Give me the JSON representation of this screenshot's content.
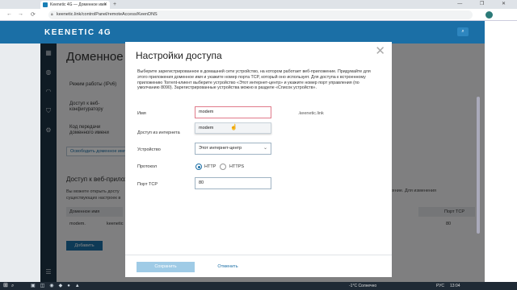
{
  "browser": {
    "tab_title": "Keenetic 4G — Доменное имя",
    "tab_close": "✕",
    "new_tab": "+",
    "window_controls": "— ❐ ✕",
    "url": "keenetic.link/controlPanel/remoteAccess/KeenDNS",
    "back": "←",
    "forward": "→",
    "reload": "⟳"
  },
  "app": {
    "brand": "KEENETIC 4G",
    "search_icon": "⌕"
  },
  "sidebar": {
    "icons": [
      "dashboard-icon",
      "globe-icon",
      "wifi-icon",
      "shield-icon",
      "gear-icon",
      "menu-icon"
    ]
  },
  "background": {
    "page_title": "Доменное",
    "labels": [
      "Режим работы (IPv6)",
      "Доступ к веб-конфигуратору",
      "Код передачи доменного имени"
    ],
    "link": "Освободить доменное имя",
    "section_title": "Доступ к веб-прилож",
    "text": "Вы можете открыть досту\nсуществующих настроек в",
    "right_text": "жение. Для изменения",
    "table_headers": [
      "Доменное имя",
      "Порт TCP"
    ],
    "table_row": [
      "modem.",
      "keenetic",
      "80"
    ],
    "add_button": "Добавить"
  },
  "dialog": {
    "title": "Настройки доступа",
    "close": "✕",
    "description": "Выберите зарегистрированное в домашней сети устройство, на котором работает веб-приложение. Придумайте для этого приложения доменное имя и укажите номер порта TCP, который оно использует. Для доступа к встроенному приложению Torrent-клиент выберите устройство «Этот интернет-центр» и укажите номер порт управления (по умолчанию 8090). Зарегистрированные устройства можно в разделе «Список устройств».",
    "fields": {
      "name_label": "Имя",
      "name_value": "modem",
      "name_suffix": ".keenetic.link",
      "suggestion": "modem",
      "access_label": "Доступ из интернета",
      "device_label": "Устройство",
      "device_value": "Этот интернет-центр",
      "protocol_label": "Протокол",
      "protocol_http": "HTTP",
      "protocol_https": "HTTPS",
      "port_label": "Порт TCP",
      "port_value": "80"
    },
    "save_button": "Сохранить",
    "cancel_button": "Отменить"
  },
  "taskbar": {
    "weather": "-1°C Солнечно",
    "lang": "РУС",
    "time": "13:04"
  },
  "colors": {
    "brand": "#1b6fa6",
    "sidebar": "#1d3446",
    "save_disabled": "#9fcbe6"
  }
}
